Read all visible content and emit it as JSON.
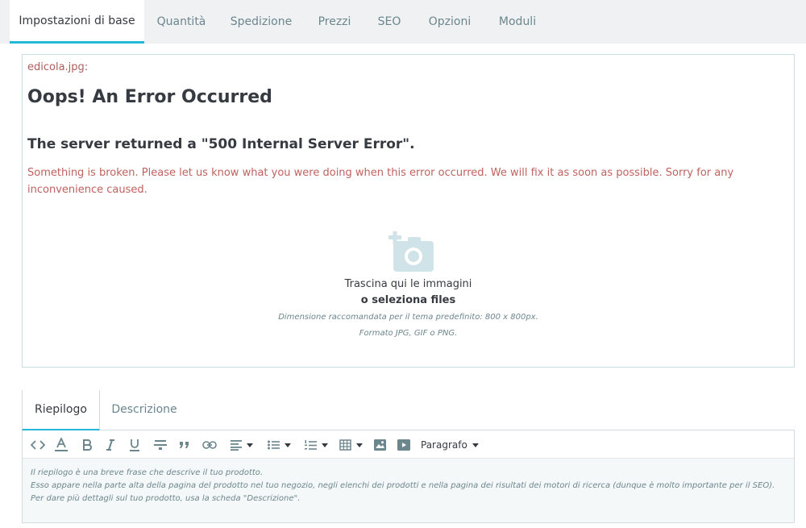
{
  "tabs": [
    {
      "label": "Impostazioni di base",
      "active": true
    },
    {
      "label": "Quantità"
    },
    {
      "label": "Spedizione"
    },
    {
      "label": "Prezzi"
    },
    {
      "label": "SEO"
    },
    {
      "label": "Opzioni"
    },
    {
      "label": "Moduli"
    }
  ],
  "error": {
    "file": "edicola.jpg:",
    "title": "Oops! An Error Occurred",
    "subtitle": "The server returned a \"500 Internal Server Error\".",
    "message": "Something is broken. Please let us know what you were doing when this error occurred. We will fix it as soon as possible. Sorry for any inconvenience caused."
  },
  "upload": {
    "icon": "add-photo-icon",
    "drag_text": "Trascina qui le immagini",
    "select_text": "o seleziona files",
    "hint_size": "Dimensione raccomandata per il tema predefinito: 800 x 800px.",
    "hint_format": "Formato JPG, GIF o PNG."
  },
  "subtabs": [
    {
      "label": "Riepilogo",
      "active": true
    },
    {
      "label": "Descrizione"
    }
  ],
  "toolbar": {
    "icons": [
      "code-icon",
      "text-color-icon",
      "bold-icon",
      "italic-icon",
      "underline-icon",
      "strikethrough-icon",
      "quote-icon",
      "link-icon",
      "align-left-icon",
      "bullet-list-icon",
      "numbered-list-icon",
      "table-icon",
      "image-icon",
      "media-icon"
    ],
    "format_label": "Paragrafo"
  },
  "editor": {
    "placeholder": [
      "Il riepilogo è una breve frase che descrive il tuo prodotto.",
      "Esso appare nella parte alta della pagina del prodotto nel tuo negozio, negli elenchi dei prodotti e nella pagina dei risultati dei motori di ricerca (dunque è molto importante per il SEO).",
      "Per dare più dettagli sul tuo prodotto, usa la scheda \"Descrizione\"."
    ]
  },
  "colors": {
    "accent": "#25b9d7",
    "error_text": "#c0625e",
    "text_dark": "#363a41",
    "text_muted": "#6c868e"
  }
}
